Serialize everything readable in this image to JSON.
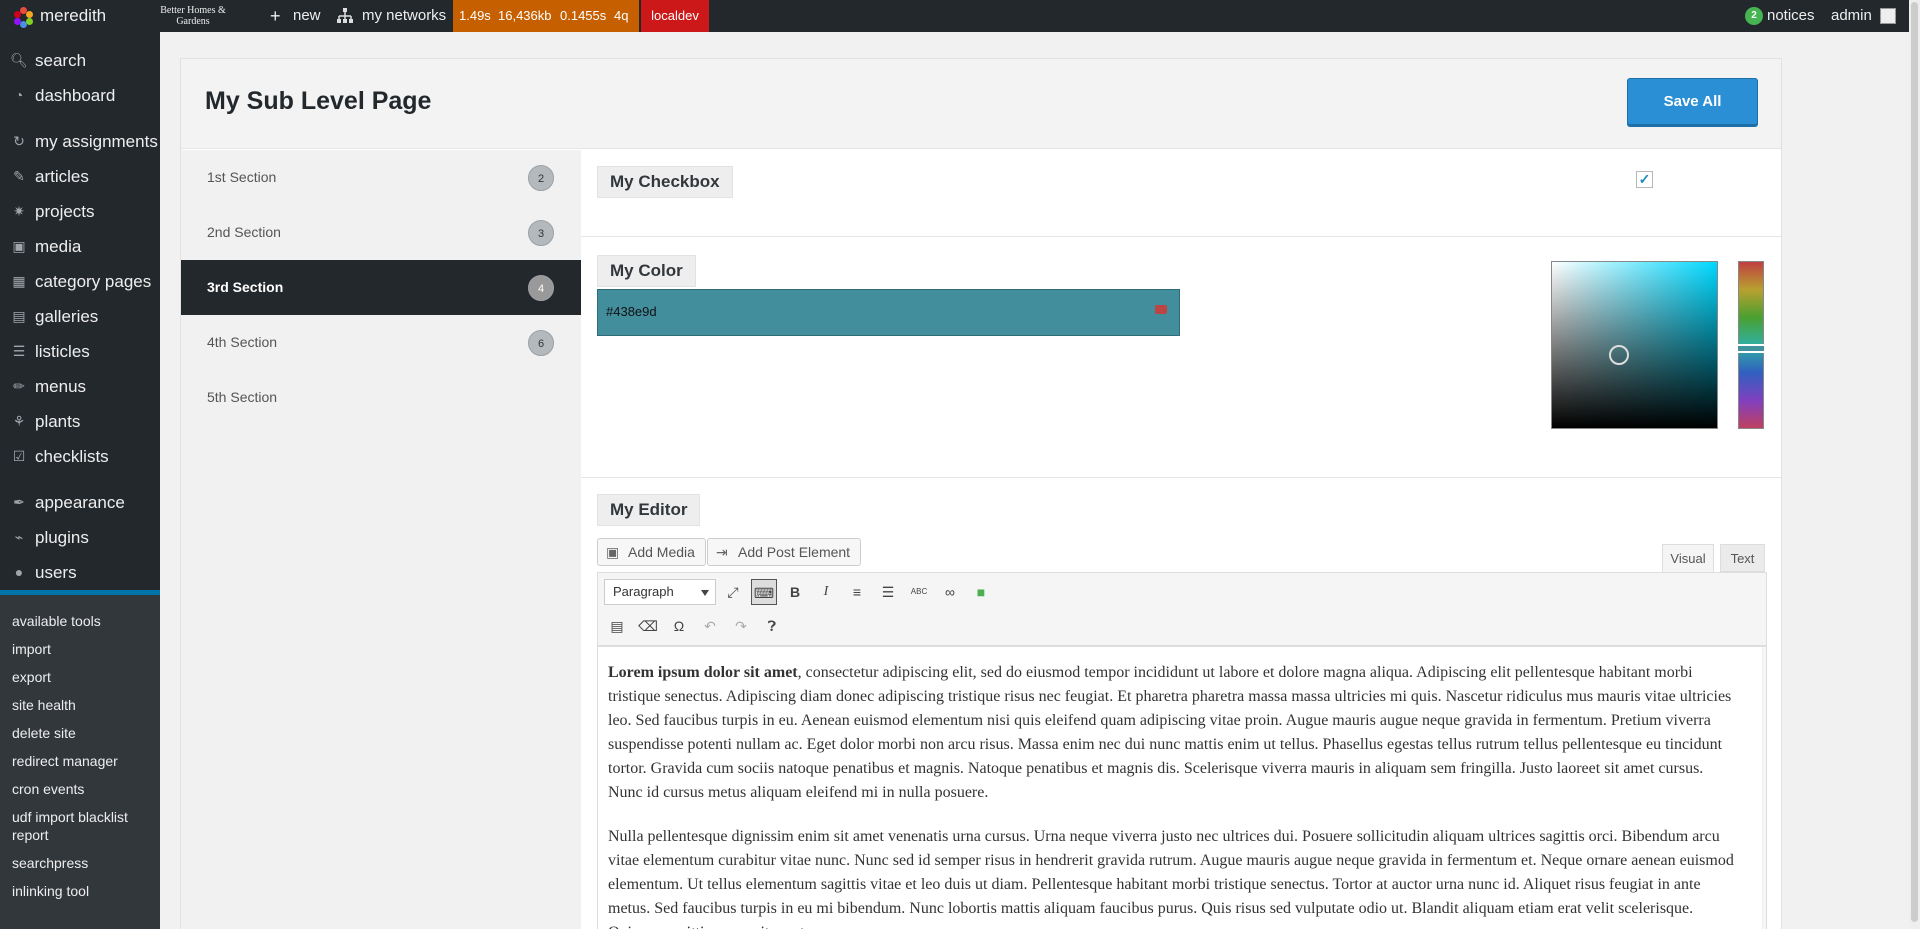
{
  "adminbar": {
    "brand": "meredith",
    "site": "Better Homes & Gardens",
    "new_label": "new",
    "networks_label": "my networks",
    "perf": {
      "time": "1.49s",
      "memory": "16,436kb",
      "query_time": "0.1455s",
      "queries": "4q"
    },
    "environment": "localdev",
    "notices_count": "2",
    "notices_label": "notices",
    "user_label": "admin"
  },
  "menu": {
    "items": [
      {
        "label": "search",
        "icon": "search-icon"
      },
      {
        "label": "dashboard",
        "icon": "dashboard-icon"
      },
      {
        "label": "my assignments",
        "icon": "assignments-icon"
      },
      {
        "label": "articles",
        "icon": "articles-icon"
      },
      {
        "label": "projects",
        "icon": "pin-icon"
      },
      {
        "label": "media",
        "icon": "media-icon"
      },
      {
        "label": "category pages",
        "icon": "category-icon"
      },
      {
        "label": "galleries",
        "icon": "galleries-icon"
      },
      {
        "label": "listicles",
        "icon": "list-icon"
      },
      {
        "label": "menus",
        "icon": "brush-icon"
      },
      {
        "label": "plants",
        "icon": "plant-icon"
      },
      {
        "label": "checklists",
        "icon": "checklist-icon"
      },
      {
        "label": "appearance",
        "icon": "appearance-icon"
      },
      {
        "label": "plugins",
        "icon": "plugin-icon"
      },
      {
        "label": "users",
        "icon": "users-icon"
      },
      {
        "label": "tools",
        "icon": "wrench-icon"
      }
    ],
    "submenu": [
      "available tools",
      "import",
      "export",
      "site health",
      "delete site",
      "redirect manager",
      "cron events",
      "udf import blacklist report",
      "searchpress",
      "inlinking tool"
    ]
  },
  "page": {
    "title": "My Sub Level Page",
    "save_label": "Save All",
    "sections": [
      {
        "label": "1st Section",
        "count": "2"
      },
      {
        "label": "2nd Section",
        "count": "3"
      },
      {
        "label": "3rd Section",
        "count": "4"
      },
      {
        "label": "4th Section",
        "count": "6"
      },
      {
        "label": "5th Section",
        "count": ""
      }
    ],
    "active_section": "3rd Section"
  },
  "fields": {
    "checkbox": {
      "label": "My Checkbox",
      "checked": true
    },
    "color": {
      "label": "My Color",
      "value": "#438e9d"
    },
    "editor": {
      "label": "My Editor",
      "add_media": "Add Media",
      "add_post_element": "Add Post Element",
      "tab_visual": "Visual",
      "tab_text": "Text",
      "format": "Paragraph",
      "para1_bold": "Lorem ipsum dolor sit amet",
      "para1_rest": ", consectetur adipiscing elit, sed do eiusmod tempor incididunt ut labore et dolore magna aliqua. Adipiscing elit pellentesque habitant morbi tristique senectus. Adipiscing diam donec adipiscing tristique risus nec feugiat. Et pharetra pharetra massa massa ultricies mi quis. Nascetur ridiculus mus mauris vitae ultricies leo. Sed faucibus turpis in eu. Aenean euismod elementum nisi quis eleifend quam adipiscing vitae proin. Augue mauris augue neque gravida in fermentum. Pretium viverra suspendisse potenti nullam ac. Eget dolor morbi non arcu risus. Massa enim nec dui nunc mattis enim ut tellus. Phasellus egestas tellus rutrum tellus pellentesque eu tincidunt tortor. Gravida cum sociis natoque penatibus et magnis. Natoque penatibus et magnis dis. Scelerisque viverra mauris in aliquam sem fringilla. Justo laoreet sit amet cursus. Nunc id cursus metus aliquam eleifend mi in nulla posuere.",
      "para2": "Nulla pellentesque dignissim enim sit amet venenatis urna cursus. Urna neque viverra justo nec ultrices dui. Posuere sollicitudin aliquam ultrices sagittis orci. Bibendum arcu vitae elementum curabitur vitae nunc. Nunc sed id semper risus in hendrerit gravida rutrum. Augue mauris augue neque gravida in fermentum et. Neque ornare aenean euismod elementum. Ut tellus elementum sagittis vitae et leo duis ut diam. Pellentesque habitant morbi tristique senectus. Tortor at auctor urna nunc id. Aliquet risus feugiat in ante metus. Sed faucibus turpis in eu mi bibendum. Nunc lobortis mattis aliquam faucibus purus. Quis risus sed vulputate odio ut. Blandit aliquam etiam erat velit scelerisque. Quisque sagittis purus sit amet."
    }
  },
  "colors": {
    "admin_bar": "#23282d",
    "accent": "#0073aa",
    "perf_bar": "#c65f00",
    "env_bar": "#cc1818",
    "save_button": "#2b8fd5"
  }
}
